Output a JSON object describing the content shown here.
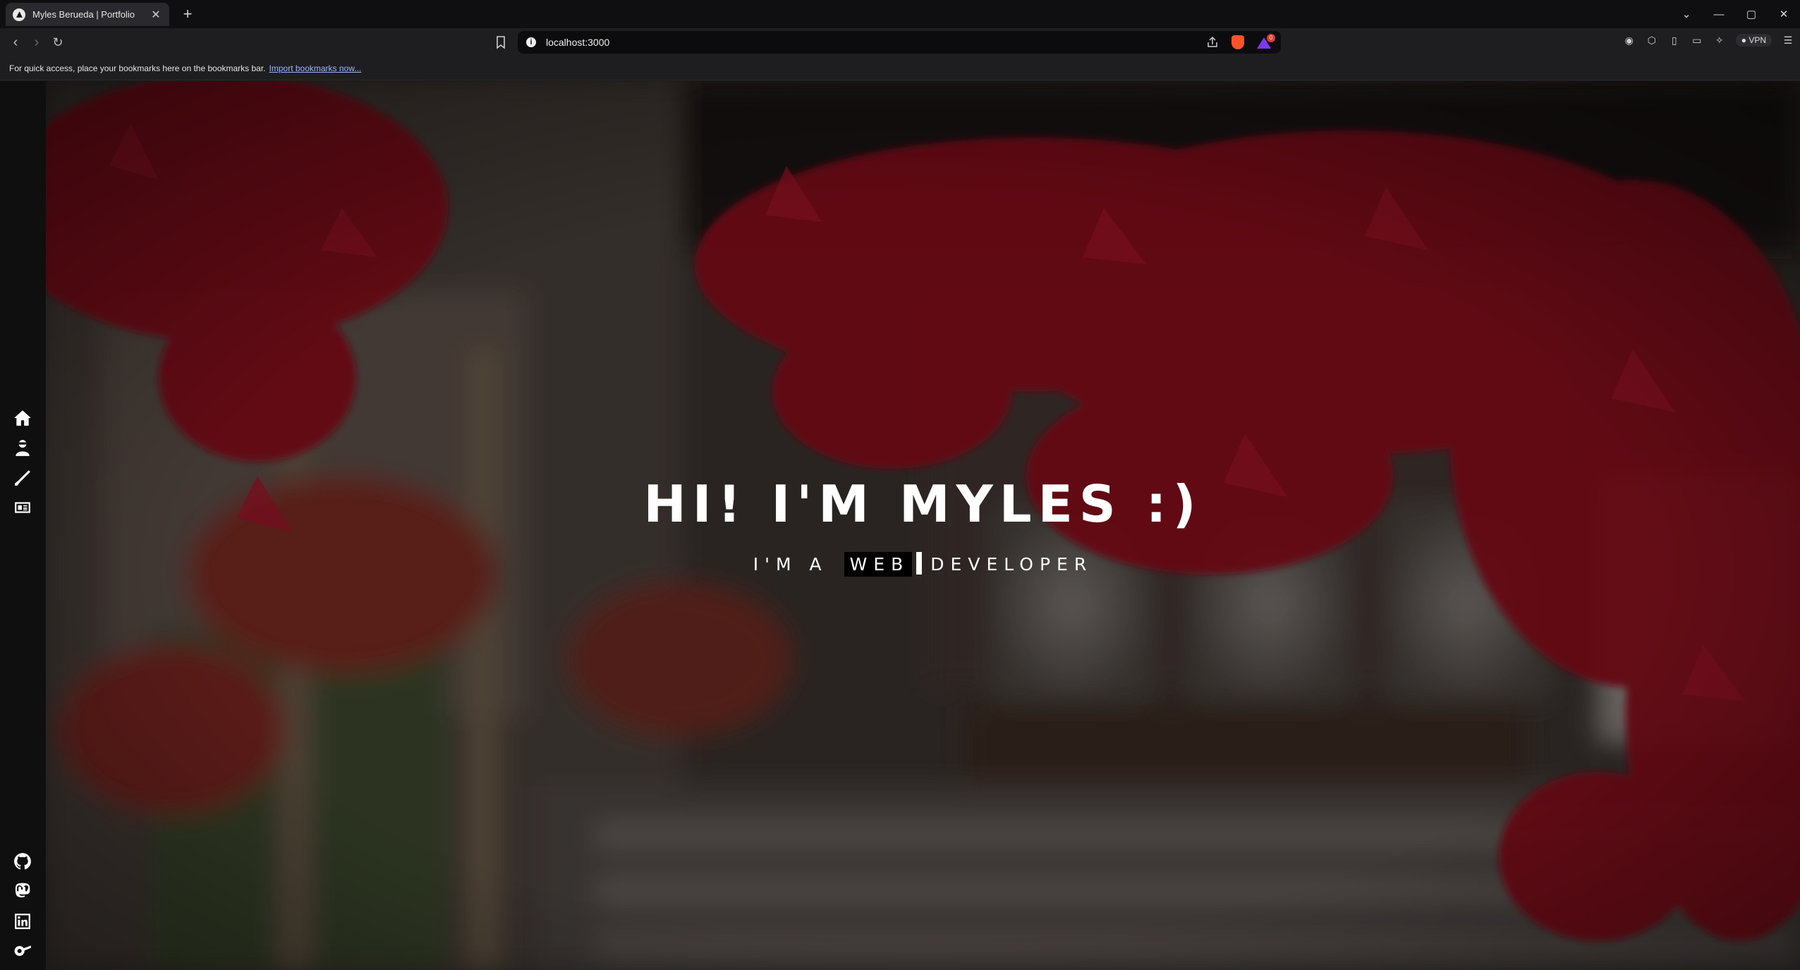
{
  "browser": {
    "tab_title": "Myles Berueda | Portfolio",
    "tab_close": "✕",
    "new_tab": "+",
    "url": "localhost:3000",
    "vpn_label": "VPN",
    "rewards_badge": "0",
    "bookmarks_text": "For quick access, place your bookmarks here on the bookmarks bar.",
    "bookmarks_link": "Import bookmarks now..."
  },
  "sidebar": {
    "nav": [
      "home-icon",
      "about-icon",
      "skills-icon",
      "projects-icon"
    ],
    "social": [
      "github-icon",
      "mastodon-icon",
      "linkedin-icon",
      "osu-icon"
    ]
  },
  "hero": {
    "headline": "HI! I'M MYLES :)",
    "sub_prefix": "I'M A",
    "sub_typed": "WEB",
    "sub_suffix": "DEVELOPER"
  },
  "colors": {
    "accent_leaves": "#8b0f1e",
    "sidebar_bg": "#0f0f10"
  }
}
